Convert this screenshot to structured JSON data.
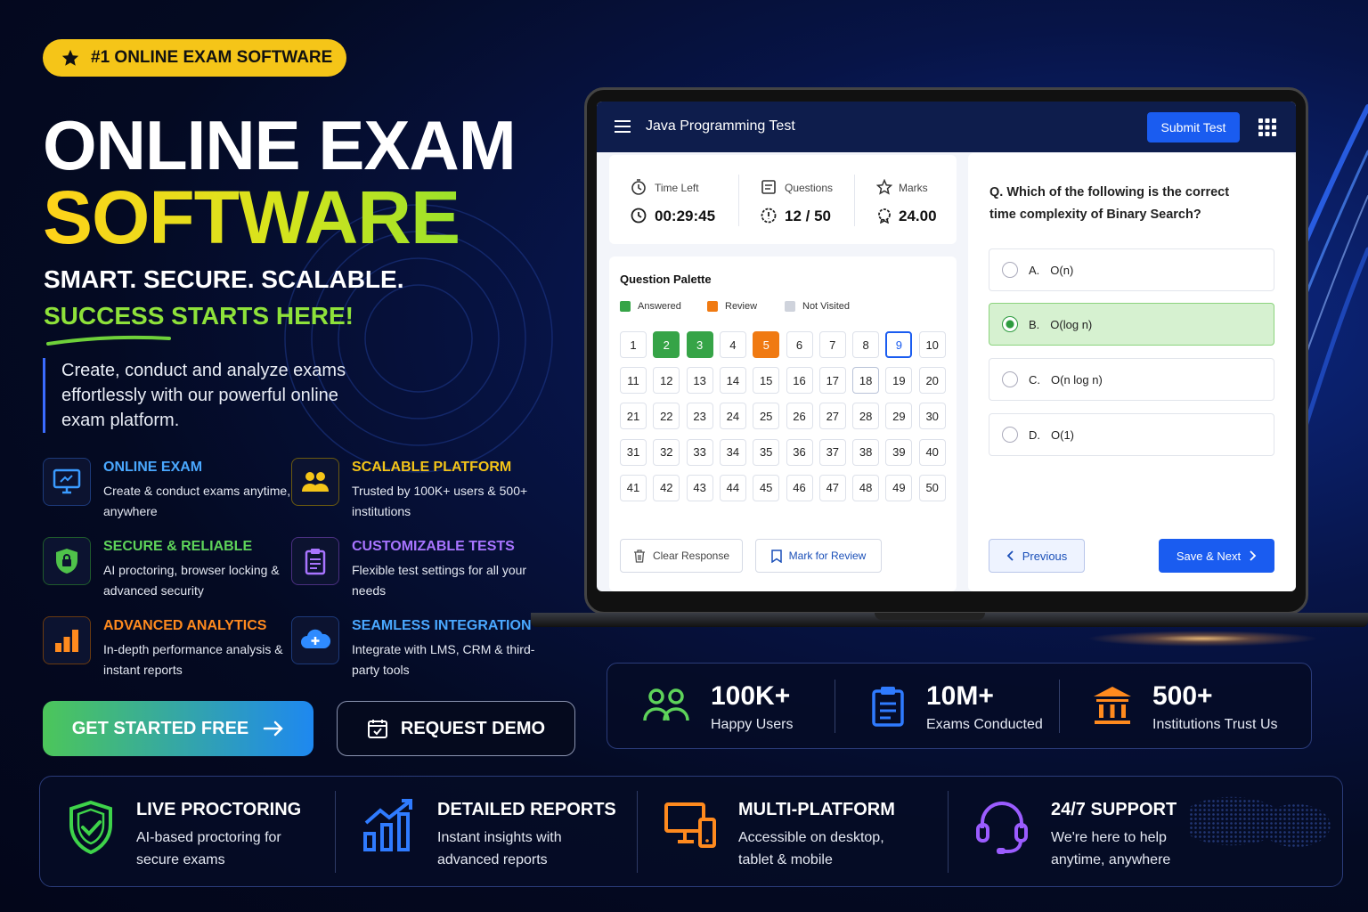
{
  "badge": {
    "text": "#1 ONLINE EXAM SOFTWARE"
  },
  "hero": {
    "line1": "ONLINE EXAM",
    "line2": "SOFTWARE",
    "tagline": "SMART. SECURE. SCALABLE.",
    "tagline2": "SUCCESS STARTS HERE!",
    "description": "Create, conduct and analyze exams effortlessly with our powerful online exam platform."
  },
  "features": [
    {
      "title": "ONLINE EXAM",
      "text": "Create & conduct exams anytime, anywhere",
      "color": "#4aa8ff",
      "icon": "monitor-icon"
    },
    {
      "title": "SCALABLE PLATFORM",
      "text": "Trusted by 100K+ users & 500+ institutions",
      "color": "#f5c518",
      "icon": "users-icon"
    },
    {
      "title": "SECURE & RELIABLE",
      "text": "AI proctoring, browser locking & advanced security",
      "color": "#5ed35a",
      "icon": "shield-lock-icon"
    },
    {
      "title": "CUSTOMIZABLE TESTS",
      "text": "Flexible test settings for all your needs",
      "color": "#a874ff",
      "icon": "clipboard-icon"
    },
    {
      "title": "ADVANCED ANALYTICS",
      "text": "In-depth performance analysis & instant reports",
      "color": "#ff8a1e",
      "icon": "bar-chart-icon"
    },
    {
      "title": "SEAMLESS INTEGRATION",
      "text": "Integrate with LMS, CRM & third-party tools",
      "color": "#4aa8ff",
      "icon": "cloud-plus-icon"
    }
  ],
  "cta": {
    "primary": "GET STARTED FREE",
    "secondary": "REQUEST DEMO"
  },
  "app": {
    "title": "Java Programming Test",
    "submit": "Submit Test",
    "stats": [
      {
        "label": "Time Left",
        "value": "00:29:45"
      },
      {
        "label": "Questions",
        "value": "12 / 50"
      },
      {
        "label": "Marks",
        "value": "24.00"
      }
    ],
    "palette": {
      "title": "Question Palette",
      "legend": [
        "Answered",
        "Review",
        "Not Visited"
      ],
      "numbers": [
        "1",
        "2",
        "3",
        "4",
        "5",
        "6",
        "7",
        "8",
        "9",
        "10",
        "11",
        "12",
        "13",
        "14",
        "15",
        "16",
        "17",
        "18",
        "19",
        "20",
        "21",
        "22",
        "23",
        "24",
        "25",
        "26",
        "27",
        "28",
        "29",
        "30",
        "31",
        "32",
        "33",
        "34",
        "35",
        "36",
        "37",
        "38",
        "39",
        "40",
        "41",
        "42",
        "43",
        "44",
        "45",
        "46",
        "47",
        "48",
        "49",
        "50"
      ],
      "answered": [
        2,
        3
      ],
      "review": [
        5
      ],
      "current": 9,
      "visited": [
        18
      ]
    },
    "clear_label": "Clear Response",
    "mark_label": "Mark for Review",
    "question": "Q. Which of the following is the correct time complexity of Binary Search?",
    "options": [
      {
        "letter": "A.",
        "text": "O(n)"
      },
      {
        "letter": "B.",
        "text": "O(log n)"
      },
      {
        "letter": "C.",
        "text": "O(n log n)"
      },
      {
        "letter": "D.",
        "text": "O(1)"
      }
    ],
    "selected_option": 1,
    "prev_label": "Previous",
    "next_label": "Save & Next"
  },
  "stats_strip": [
    {
      "number": "100K+",
      "caption": "Happy Users",
      "icon": "users-icon",
      "color": "#5ed35a"
    },
    {
      "number": "10M+",
      "caption": "Exams Conducted",
      "icon": "clipboard-icon",
      "color": "#2f7bff"
    },
    {
      "number": "500+",
      "caption": "Institutions Trust Us",
      "icon": "institution-icon",
      "color": "#ff8a1e"
    }
  ],
  "bottom": [
    {
      "title": "LIVE PROCTORING",
      "text": "AI-based proctoring for secure exams",
      "icon": "shield-check-icon",
      "color": "#3ed34a"
    },
    {
      "title": "DETAILED REPORTS",
      "text": "Instant insights with advanced reports",
      "icon": "growth-chart-icon",
      "color": "#2f7bff"
    },
    {
      "title": "MULTI-PLATFORM",
      "text": "Accessible on desktop, tablet & mobile",
      "icon": "devices-icon",
      "color": "#ff8a1e"
    },
    {
      "title": "24/7 SUPPORT",
      "text": "We're here to help anytime, anywhere",
      "icon": "headset-icon",
      "color": "#9b5cff"
    }
  ]
}
